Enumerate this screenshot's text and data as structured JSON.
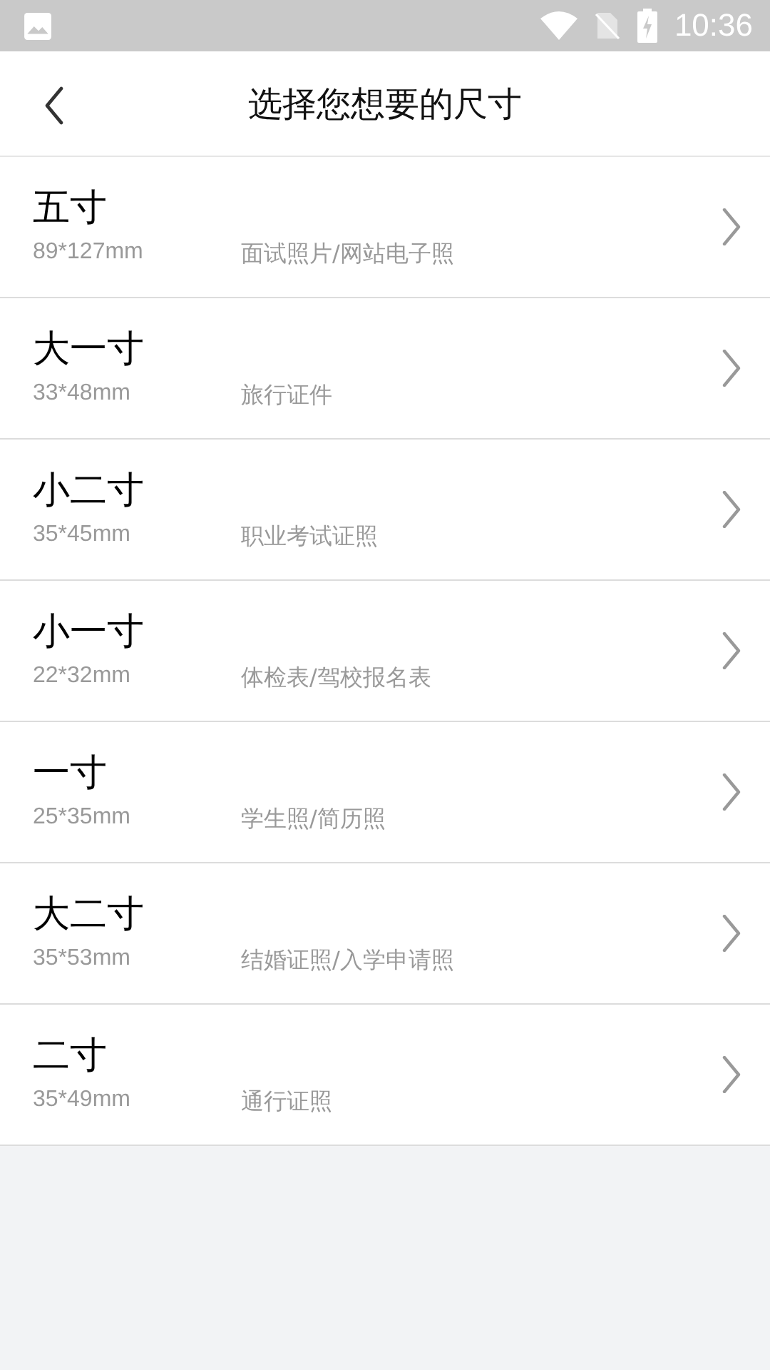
{
  "status_bar": {
    "time": "10:36"
  },
  "header": {
    "title": "选择您想要的尺寸"
  },
  "sizes": [
    {
      "name": "五寸",
      "dimensions": "89*127mm",
      "usage": "面试照片/网站电子照"
    },
    {
      "name": "大一寸",
      "dimensions": "33*48mm",
      "usage": "旅行证件"
    },
    {
      "name": "小二寸",
      "dimensions": "35*45mm",
      "usage": "职业考试证照"
    },
    {
      "name": "小一寸",
      "dimensions": "22*32mm",
      "usage": "体检表/驾校报名表"
    },
    {
      "name": "一寸",
      "dimensions": "25*35mm",
      "usage": "学生照/简历照"
    },
    {
      "name": "大二寸",
      "dimensions": "35*53mm",
      "usage": "结婚证照/入学申请照"
    },
    {
      "name": "二寸",
      "dimensions": "35*49mm",
      "usage": "通行证照"
    }
  ]
}
